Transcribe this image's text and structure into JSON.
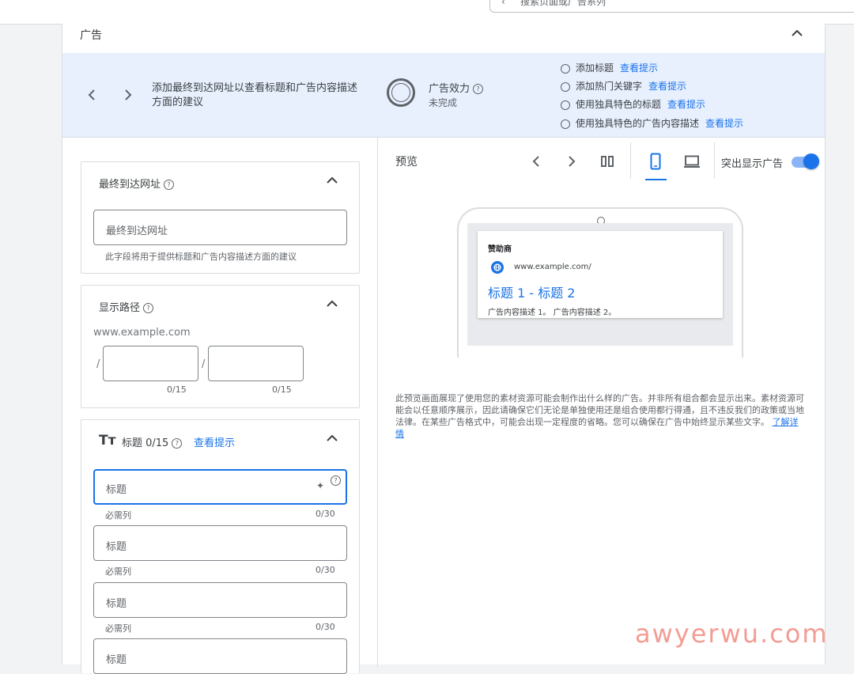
{
  "topbar": {
    "search_text": "搜索页面或广告系列"
  },
  "panel": {
    "title": "广告"
  },
  "suggestions": {
    "text": "添加最终到达网址以查看标题和广告内容描述方面的建议",
    "effect_label": "广告效力",
    "effect_status": "未完成",
    "tips": [
      {
        "label": "添加标题",
        "link": "查看提示"
      },
      {
        "label": "添加热门关键字",
        "link": "查看提示"
      },
      {
        "label": "使用独具特色的标题",
        "link": "查看提示"
      },
      {
        "label": "使用独具特色的广告内容描述",
        "link": "查看提示"
      }
    ]
  },
  "final_url": {
    "title": "最终到达网址",
    "placeholder": "最终到达网址",
    "helper": "此字段将用于提供标题和广告内容描述方面的建议"
  },
  "display_path": {
    "title": "显示路径",
    "domain": "www.example.com",
    "separator": "/",
    "counts": [
      "0/15",
      "0/15"
    ]
  },
  "headlines": {
    "icon_text": "Tт",
    "title": "标题 0/15",
    "link": "查看提示",
    "fields": [
      {
        "placeholder": "标题",
        "helper": "必需列",
        "count": "0/30"
      },
      {
        "placeholder": "标题",
        "helper": "必需列",
        "count": "0/30"
      },
      {
        "placeholder": "标题",
        "helper": "必需列",
        "count": "0/30"
      },
      {
        "placeholder": "标题"
      }
    ]
  },
  "preview": {
    "label": "预览",
    "toggle_label": "突出显示广告",
    "toggle_on": true,
    "ad": {
      "sponsor": "赞助商",
      "url": "www.example.com/",
      "headline": "标题 1 - 标题 2",
      "description": "广告内容描述 1。 广告内容描述 2。"
    },
    "disclaimer": "此预览画面展现了使用您的素材资源可能会制作出什么样的广告。并非所有组合都会显示出来。素材资源可能会以任意顺序展示，因此请确保它们无论是单独使用还是组合使用都行得通，且不违反我们的政策或当地法律。在某些广告格式中，可能会出现一定程度的省略。您可以确保在广告中始终显示某些文字。",
    "learn_more": "了解详情"
  },
  "watermark": "awyerwu.com",
  "colors": {
    "accent": "#1a73e8",
    "suggest_bg": "#e8f0fe",
    "watermark": "#f28b82"
  }
}
